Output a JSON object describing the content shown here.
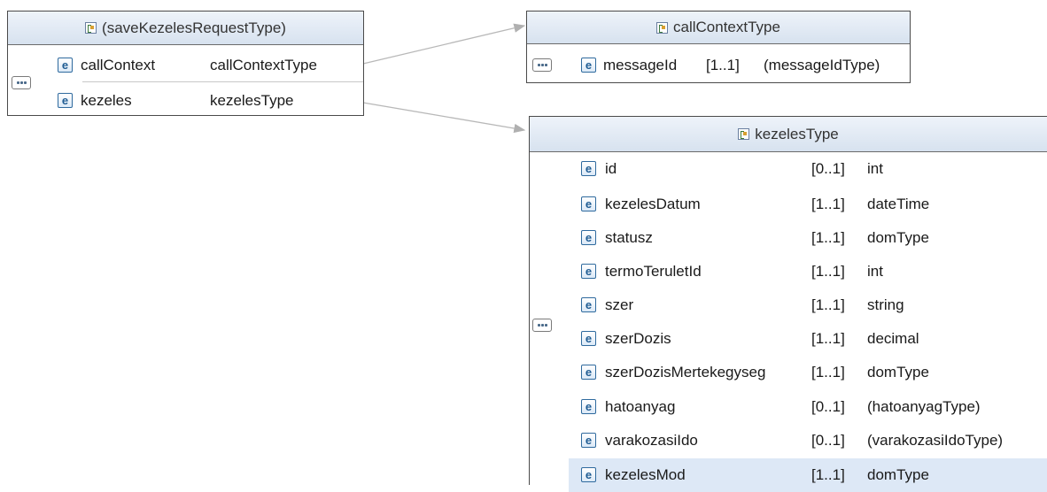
{
  "request": {
    "title": "(saveKezelesRequestType)",
    "rows": [
      {
        "name": "callContext",
        "type": "callContextType"
      },
      {
        "name": "kezeles",
        "type": "kezelesType"
      }
    ]
  },
  "callContext": {
    "title": "callContextType",
    "rows": [
      {
        "name": "messageId",
        "card": "[1..1]",
        "type": "(messageIdType)"
      }
    ]
  },
  "kezeles": {
    "title": "kezelesType",
    "rows": [
      {
        "name": "id",
        "card": "[0..1]",
        "type": "int"
      },
      {
        "name": "kezelesDatum",
        "card": "[1..1]",
        "type": "dateTime"
      },
      {
        "name": "statusz",
        "card": "[1..1]",
        "type": "domType"
      },
      {
        "name": "termoTeruletId",
        "card": "[1..1]",
        "type": "int"
      },
      {
        "name": "szer",
        "card": "[1..1]",
        "type": "string"
      },
      {
        "name": "szerDozis",
        "card": "[1..1]",
        "type": "decimal"
      },
      {
        "name": "szerDozisMertekegyseg",
        "card": "[1..1]",
        "type": "domType"
      },
      {
        "name": "hatoanyag",
        "card": "[0..1]",
        "type": "(hatoanyagType)"
      },
      {
        "name": "varakozasiIdo",
        "card": "[0..1]",
        "type": "(varakozasiIdoType)"
      },
      {
        "name": "kezelesMod",
        "card": "[1..1]",
        "type": "domType"
      }
    ]
  },
  "element_icon_letter": "e",
  "colors": {
    "header": "#dbe5f1",
    "selected_row": "#dde8f6",
    "border": "#4a4a4a",
    "connector": "#b5b5b5"
  }
}
